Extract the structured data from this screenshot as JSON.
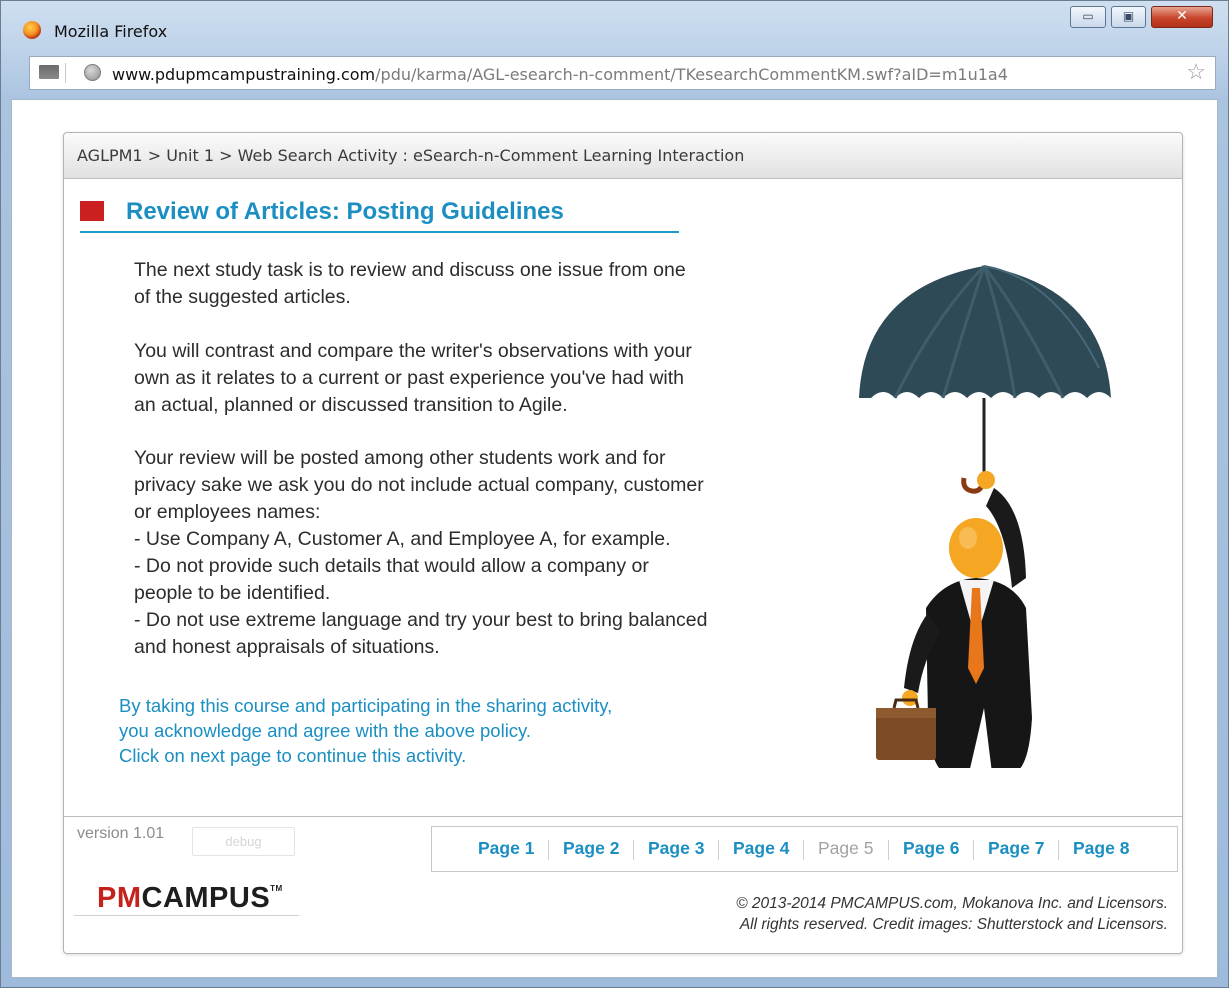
{
  "window": {
    "title": "Mozilla Firefox",
    "url_domain": "www.pdupmcampustraining.com",
    "url_path": "/pdu/karma/AGL-esearch-n-comment/TKesearchCommentKM.swf?aID=m1u1a4"
  },
  "header": {
    "breadcrumb": "AGLPM1 > Unit 1 > Web Search Activity : eSearch-n-Comment Learning Interaction"
  },
  "main": {
    "title": "Review of Articles: Posting Guidelines",
    "paragraphs": [
      [
        "The next study task is to review and discuss one issue from one",
        "of the suggested articles."
      ],
      [
        "You will contrast and compare the writer's observations with your",
        "own as it relates to a current or past experience you've had with",
        "an actual, planned or discussed transition to Agile."
      ],
      [
        "Your review will be posted among other students work and for",
        "privacy sake we ask you do not include actual company, customer",
        "or employees names:",
        "- Use Company A, Customer A, and Employee A, for example.",
        "- Do not provide such details that would allow a company or",
        "people to be identified.",
        "- Do not use extreme language and try your best to bring balanced",
        "and honest appraisals of situations."
      ]
    ],
    "notice": [
      "By taking this course and participating in the sharing activity,",
      "you acknowledge and agree with the above policy.",
      "Click on next page to continue this activity."
    ]
  },
  "footer": {
    "version": "version 1.01",
    "debug_label": "debug",
    "pages": [
      {
        "label": "Page 1",
        "enabled": true
      },
      {
        "label": "Page 2",
        "enabled": true
      },
      {
        "label": "Page 3",
        "enabled": true
      },
      {
        "label": "Page 4",
        "enabled": true
      },
      {
        "label": "Page 5",
        "enabled": false
      },
      {
        "label": "Page 6",
        "enabled": true
      },
      {
        "label": "Page 7",
        "enabled": true
      },
      {
        "label": "Page 8",
        "enabled": true
      }
    ],
    "logo": {
      "pm": "PM",
      "campus": "CAMPUS",
      "tm": "TM"
    },
    "copyright": [
      "© 2013-2014 PMCAMPUS.com, Mokanova Inc. and Licensors.",
      "All rights reserved. Credit images: Shutterstock and Licensors."
    ]
  },
  "icons": {
    "browser": "firefox-icon",
    "page": "page-icon",
    "site": "globe-icon",
    "bookmark": "star-icon",
    "title_marker": "red-square-icon",
    "illustration": "businessman-umbrella-illustration"
  },
  "colors": {
    "accent": "#1b8ec2",
    "title_marker": "#cc1f1f",
    "logo_pm": "#c4221b"
  }
}
